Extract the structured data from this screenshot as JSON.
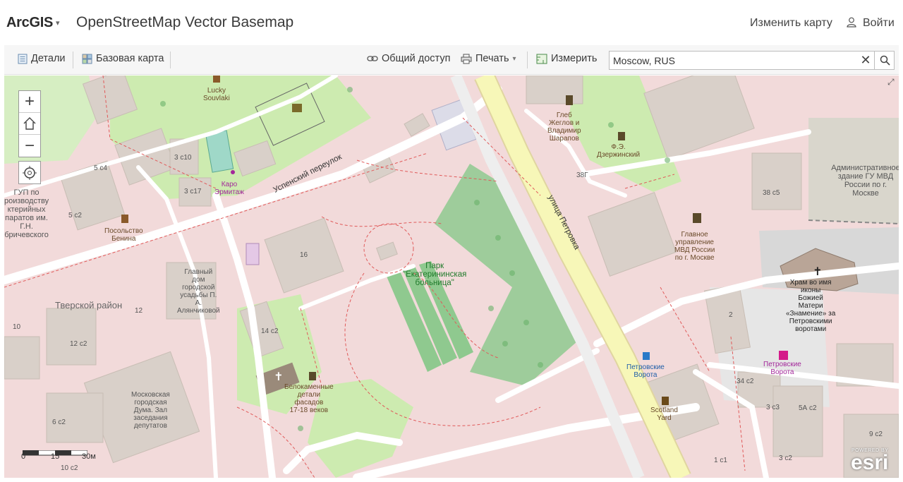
{
  "header": {
    "brand": "ArcGIS",
    "title": "OpenStreetMap Vector Basemap",
    "change_map": "Изменить карту",
    "signin": "Войти"
  },
  "toolbar": {
    "details": "Детали",
    "basemap": "Базовая карта",
    "share": "Общий доступ",
    "print": "Печать",
    "measure": "Измерить"
  },
  "search": {
    "value": "Moscow, RUS"
  },
  "map": {
    "labels": {
      "lucky": "Lucky\nSouvlaki",
      "gleb": "Глеб\nЖеглов и\nВладимир\nШарапов",
      "dzerzh": "Ф.Э.\nДзержинский",
      "admin": "Административное\nздание ГУ МВД\nРоссии по г.\nМоскве",
      "gup": "ГУП по\nроизводству\nктерийных\nпаратов им.\nГ.Н.\nбричевского",
      "s5c4": "5 с4",
      "s3c10": "3 с10",
      "s3c17": "3 с17",
      "karo": "Каро\nЭрмитаж",
      "s5c2": "5 с2",
      "posolstvo": "Посольство\nБенина",
      "uspensky": "Успенский переулок",
      "petrovka": "улица Петровка",
      "s38g": "38Г",
      "s38c5": "38 с5",
      "mvd": "Главное\nуправление\nМВД России\nпо г. Москве",
      "park": "Парк\n\"Екатерининская\nбольница\"",
      "s16": "16",
      "glavny": "Главный\nдом\nгородской\nусадьбы П.\nА.\nАлянчиковой",
      "tverskoy": "Тверской район",
      "s12": "12",
      "s10": "10",
      "s12c2": "12 с2",
      "s14c2": "14 с2",
      "hram": "Храм во имя\nиконы\nБожией\nМатери\n«Знамение» за\nПетровскими\nворотами",
      "s2": "2",
      "petrvorota_stop": "Петровские\nВорота",
      "petrvorota_ph": "Петровские\nВорота",
      "belokam": "Белокаменные\nдетали\nфасадов\n17-18 веков",
      "duma": "Московская\nгородская\nДума. Зал\nзаседания\nдепутатов",
      "s6c2": "6 с2",
      "s34c2": "34 с2",
      "s3c3": "3 с3",
      "s5ac2": "5А с2",
      "scotland": "Scotland\nYard",
      "s9c2": "9 с2",
      "s1c1": "1 с1",
      "s3c2": "3 с2",
      "s10c2": "10 с2"
    },
    "scale": {
      "t0": "0",
      "t1": "15",
      "t2": "30м"
    },
    "attribution": {
      "powered": "POWERED BY",
      "logo": "esri"
    }
  },
  "colors": {
    "park": "#8fc98f",
    "green_area": "#cdebb0",
    "residential": "#f2dada",
    "road_yellow": "#f7f7b8",
    "building": "#d9d0c9"
  }
}
